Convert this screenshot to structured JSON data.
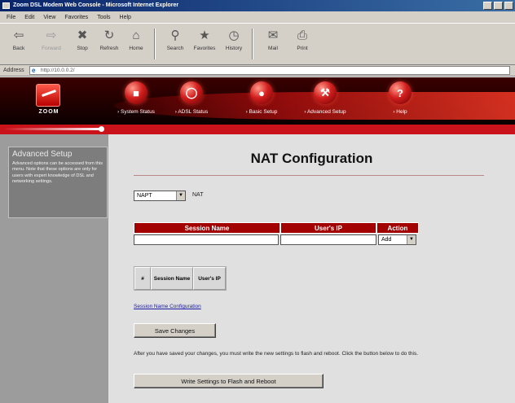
{
  "window": {
    "title": "Zoom DSL Modem Web Console - Microsoft Internet Explorer"
  },
  "menu": [
    "File",
    "Edit",
    "View",
    "Favorites",
    "Tools",
    "Help"
  ],
  "toolbar": {
    "buttons": [
      {
        "label": "Back",
        "icon": "back-arrow-icon"
      },
      {
        "label": "Forward",
        "icon": "forward-arrow-icon"
      },
      {
        "label": "Stop",
        "icon": "stop-icon"
      },
      {
        "label": "Refresh",
        "icon": "refresh-icon"
      },
      {
        "label": "Home",
        "icon": "home-icon"
      },
      {
        "label": "Search",
        "icon": "search-icon"
      },
      {
        "label": "Favorites",
        "icon": "favorites-icon"
      },
      {
        "label": "History",
        "icon": "history-icon"
      },
      {
        "label": "Mail",
        "icon": "mail-icon"
      },
      {
        "label": "Print",
        "icon": "print-icon"
      }
    ]
  },
  "address": {
    "label": "Address",
    "url": "http://10.0.0.2/"
  },
  "header": {
    "logo_text": "ZOOM",
    "nav": [
      {
        "label": "› System Status"
      },
      {
        "label": "› ADSL Status"
      },
      {
        "label": "› Basic Setup"
      },
      {
        "label": "› Advanced Setup"
      },
      {
        "label": "› Help",
        "glyph": "?"
      }
    ]
  },
  "sidebar": {
    "heading": "Advanced Setup",
    "text": "Advanced options can be accessed from this menu. Note that these options are only for users with expert knowledge of DSL and networking settings."
  },
  "main": {
    "title": "NAT Configuration",
    "nat_mode": "NAPT",
    "nat_label": "NAT",
    "session_table": {
      "headers": [
        "Session Name",
        "User's IP",
        "Action"
      ],
      "action_value": "Add"
    },
    "list_table": {
      "headers": [
        "#",
        "Session Name",
        "User's IP"
      ]
    },
    "config_link": "Session Name Configuration",
    "save_label": "Save Changes",
    "note": "After you have saved your changes, you must write the new settings to flash and reboot. Click the button below to do this.",
    "flash_label": "Write Settings to Flash and Reboot"
  },
  "colors": {
    "accent": "#a30000",
    "sidebar": "#9c9c9c",
    "content_bg": "#e0e0e0"
  }
}
